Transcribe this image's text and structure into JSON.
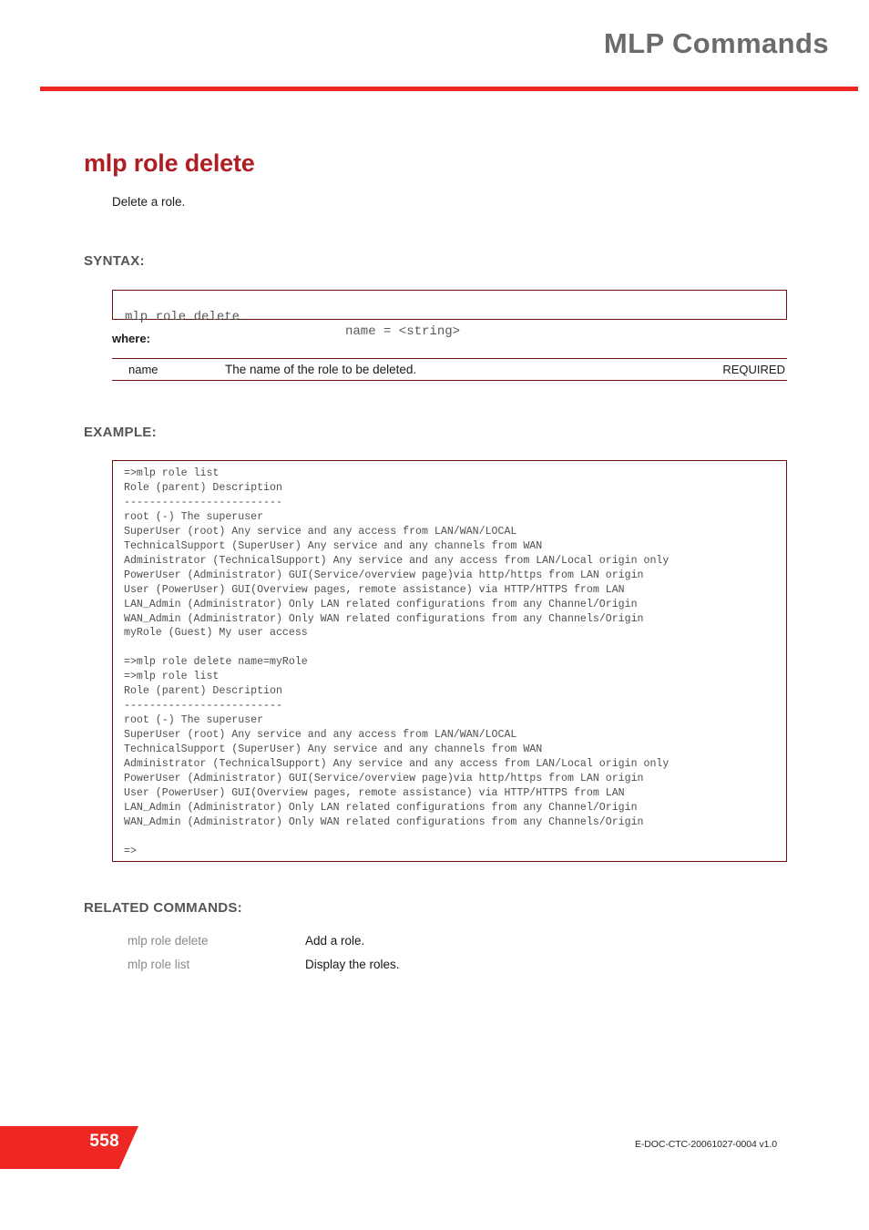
{
  "header": {
    "title": "MLP Commands",
    "rule_color": "#ee2722"
  },
  "command": {
    "title": "mlp role delete",
    "title_color": "#ad1f24",
    "description": "Delete a role."
  },
  "sections": {
    "syntax_label": "SYNTAX:",
    "example_label": "EXAMPLE:",
    "related_label": "RELATED COMMANDS:",
    "where_label": "where:"
  },
  "syntax": {
    "command": "mlp role delete",
    "argument": "name = <string>",
    "border_color": "#6e1113"
  },
  "where_table": {
    "rows": [
      {
        "name": "name",
        "description": "The name of the role to be deleted.",
        "requirement": "REQUIRED"
      }
    ]
  },
  "example": {
    "text": "=>mlp role list\nRole (parent) Description\n-------------------------\nroot (-) The superuser\nSuperUser (root) Any service and any access from LAN/WAN/LOCAL\nTechnicalSupport (SuperUser) Any service and any channels from WAN\nAdministrator (TechnicalSupport) Any service and any access from LAN/Local origin only\nPowerUser (Administrator) GUI(Service/overview page)via http/https from LAN origin\nUser (PowerUser) GUI(Overview pages, remote assistance) via HTTP/HTTPS from LAN\nLAN_Admin (Administrator) Only LAN related configurations from any Channel/Origin\nWAN_Admin (Administrator) Only WAN related configurations from any Channels/Origin\nmyRole (Guest) My user access\n\n=>mlp role delete name=myRole\n=>mlp role list\nRole (parent) Description\n-------------------------\nroot (-) The superuser\nSuperUser (root) Any service and any access from LAN/WAN/LOCAL\nTechnicalSupport (SuperUser) Any service and any channels from WAN\nAdministrator (TechnicalSupport) Any service and any access from LAN/Local origin only\nPowerUser (Administrator) GUI(Service/overview page)via http/https from LAN origin\nUser (PowerUser) GUI(Overview pages, remote assistance) via HTTP/HTTPS from LAN\nLAN_Admin (Administrator) Only LAN related configurations from any Channel/Origin\nWAN_Admin (Administrator) Only WAN related configurations from any Channels/Origin\n\n=>"
  },
  "related_commands": [
    {
      "command": "mlp role delete",
      "description": "Add a role."
    },
    {
      "command": "mlp role list",
      "description": "Display the roles."
    }
  ],
  "footer": {
    "page_number": "558",
    "doc_id": "E-DOC-CTC-20061027-0004 v1.0",
    "tab_color": "#ee2722"
  }
}
